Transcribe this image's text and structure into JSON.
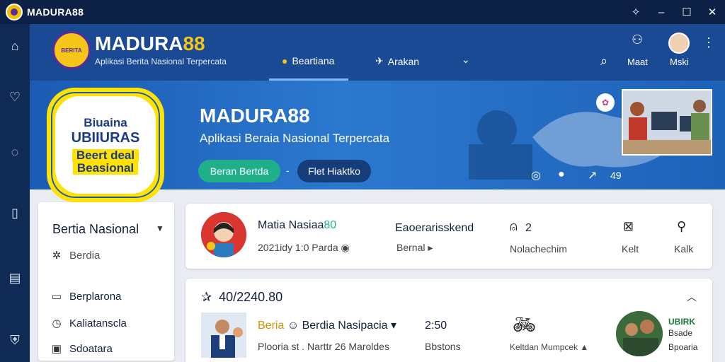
{
  "window": {
    "title": "MADURA88"
  },
  "header": {
    "badge_text": "BERITA",
    "brand_main": "MADURA",
    "brand_num": "88",
    "tagline": "Aplikasi Berita Nasional Terpercata",
    "tabs": [
      {
        "label": "Beartiana",
        "icon": "person-icon"
      },
      {
        "label": "Arakan",
        "icon": "plane-icon"
      }
    ],
    "right_labels": [
      "Maat",
      "Mski"
    ]
  },
  "banner": {
    "title": "MADURA88",
    "subtitle": "Aplikasi Beraia Nasional Terpercata",
    "btn_primary": "Beran Bertda",
    "separator": "-",
    "btn_secondary": "Flet Hiaktko",
    "controls_count": "49"
  },
  "promo": {
    "line1": "Biuaina",
    "line2": "UBIIURAS",
    "line3": "Beert deal",
    "line4": "Beasional"
  },
  "sidebar": {
    "heading": "Bertia Nasional",
    "items": [
      {
        "label": "Berdia",
        "icon": "sparkle-icon"
      },
      {
        "label": "Berplarona",
        "icon": "doc-icon"
      },
      {
        "label": "Kaliatanscla",
        "icon": "clock-icon"
      },
      {
        "label": "Sdoatara",
        "icon": "image-icon"
      }
    ]
  },
  "card1": {
    "name_main": "Matia Nasiaa",
    "name_hl": "80",
    "date": "2021idy 1:0 Parda",
    "col1_title": "Eaoerarisskend",
    "col1_sub": "Bernal",
    "col2_title": "2",
    "col2_sub": "Nolachechim",
    "action1": "Kelt",
    "action2": "Kalk"
  },
  "card2": {
    "heading": "40/2240.80",
    "title_y": "Beria",
    "title_rest": "Berdia Nasipacia",
    "meta": "Plooria st . Narttr 26 Maroldes",
    "time": "2:50",
    "time_sub": "Bbstons",
    "bike_label": "Keltdan Mumpcek",
    "side1": "UBIRK",
    "side2": "Bsade",
    "side3": "Bpoaria"
  },
  "colors": {
    "titlebar": "#0d2147",
    "header": "#1a4a93",
    "accent_green": "#1fb08a",
    "accent_yellow": "#f5c518"
  }
}
